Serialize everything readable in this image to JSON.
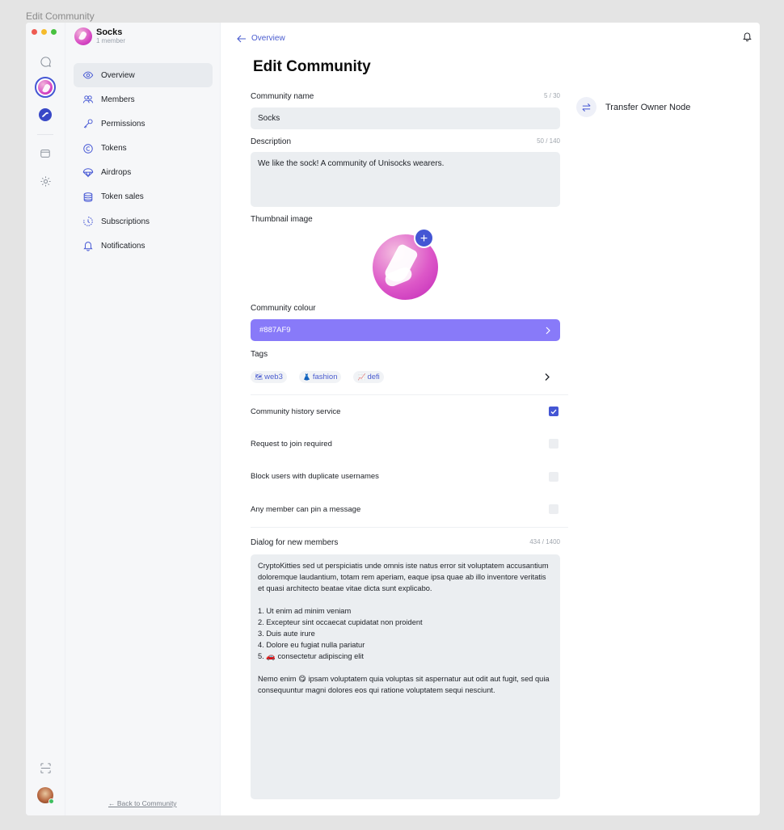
{
  "window_title": "Edit Community",
  "community": {
    "name": "Socks",
    "members": "1 member"
  },
  "nav": [
    {
      "label": "Overview",
      "icon": "eye-icon",
      "active": true
    },
    {
      "label": "Members",
      "icon": "members-icon"
    },
    {
      "label": "Permissions",
      "icon": "key-icon"
    },
    {
      "label": "Tokens",
      "icon": "token-icon"
    },
    {
      "label": "Airdrops",
      "icon": "parachute-icon"
    },
    {
      "label": "Token sales",
      "icon": "coins-icon"
    },
    {
      "label": "Subscriptions",
      "icon": "clock-refresh-icon"
    },
    {
      "label": "Notifications",
      "icon": "bell-icon"
    }
  ],
  "back_link": "← Back to Community",
  "breadcrumb": "Overview",
  "page_title": "Edit Community",
  "form": {
    "name_label": "Community name",
    "name_counter": "5 / 30",
    "name_value": "Socks",
    "desc_label": "Description",
    "desc_counter": "50 / 140",
    "desc_value": "We like the sock! A community of Unisocks wearers.",
    "thumb_label": "Thumbnail image",
    "colour_label": "Community colour",
    "colour_value": "#887AF9",
    "tags_label": "Tags",
    "tags": [
      {
        "emoji": "🗺",
        "label": "web3"
      },
      {
        "emoji": "👗",
        "label": "fashion"
      },
      {
        "emoji": "📈",
        "label": "defi"
      }
    ],
    "toggles": [
      {
        "label": "Community history service",
        "checked": true
      },
      {
        "label": "Request to join required",
        "checked": false
      },
      {
        "label": "Block users with duplicate usernames",
        "checked": false
      },
      {
        "label": "Any member can pin a message",
        "checked": false
      }
    ],
    "dialog_label": "Dialog for new members",
    "dialog_counter": "434 / 1400",
    "dialog_value": "CryptoKitties sed ut perspiciatis unde omnis iste natus error sit voluptatem accusantium doloremque laudantium, totam rem aperiam, eaque ipsa quae ab illo inventore veritatis et quasi architecto beatae vitae dicta sunt explicabo.\n\n1. Ut enim ad minim veniam\n2. Excepteur sint occaecat cupidatat non proident\n3. Duis aute irure\n4. Dolore eu fugiat nulla pariatur\n5. 🚗 consectetur adipiscing elit\n\nNemo enim 😋 ipsam voluptatem quia voluptas sit aspernatur aut odit aut fugit, sed quia consequuntur magni dolores eos qui ratione voluptatem sequi nesciunt."
  },
  "transfer_label": "Transfer Owner Node",
  "colors": {
    "accent": "#4456D4",
    "community": "#887AF9"
  }
}
